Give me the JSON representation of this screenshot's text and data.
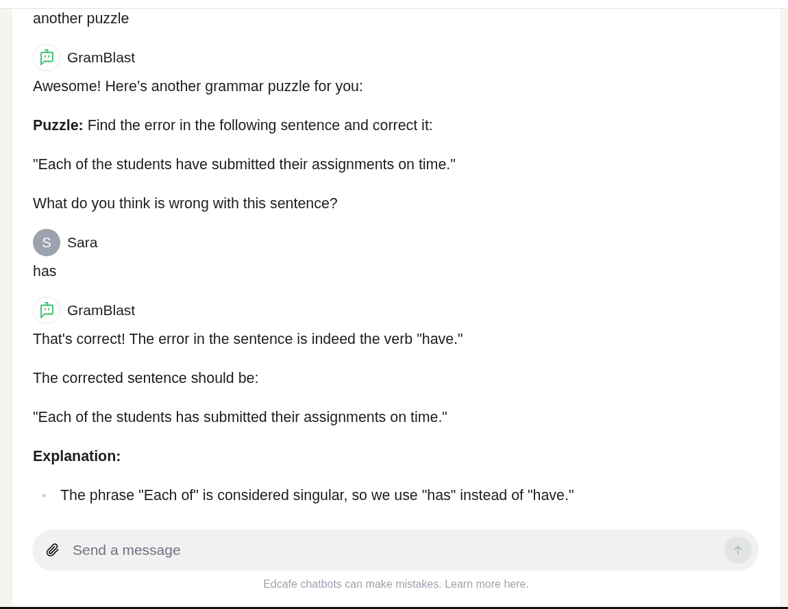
{
  "messages": [
    {
      "blocks": [
        {
          "kind": "paragraph",
          "text": "another puzzle"
        }
      ]
    },
    {
      "sender": {
        "kind": "bot",
        "name": "GramBlast"
      },
      "blocks": [
        {
          "kind": "paragraph",
          "text": "Awesome! Here’s another grammar puzzle for you:"
        },
        {
          "kind": "paragraph",
          "text": "**Puzzle:** Find the error in the following sentence and correct it:"
        },
        {
          "kind": "paragraph",
          "text": "\"Each of the students have submitted their assignments on time.\""
        },
        {
          "kind": "paragraph",
          "text": "What do you think is wrong with this sentence?"
        }
      ]
    },
    {
      "sender": {
        "kind": "user",
        "name": "Sara",
        "initial": "S"
      },
      "blocks": [
        {
          "kind": "paragraph",
          "text": "has"
        }
      ]
    },
    {
      "sender": {
        "kind": "bot",
        "name": "GramBlast"
      },
      "blocks": [
        {
          "kind": "paragraph",
          "text": "That's correct! The error in the sentence is indeed the verb \"have.\""
        },
        {
          "kind": "paragraph",
          "text": "The corrected sentence should be:"
        },
        {
          "kind": "paragraph",
          "text": "\"Each of the students has submitted their assignments on time.\""
        },
        {
          "kind": "heading",
          "text": "Explanation:"
        },
        {
          "kind": "list",
          "items": [
            "The phrase \"Each of\" is considered singular, so we use \"has\" instead of \"have.\""
          ]
        }
      ]
    }
  ],
  "composer": {
    "placeholder": "Send a message",
    "send_button": {
      "disabled": true
    }
  },
  "footer": {
    "text": "Edcafe chatbots can make mistakes. Learn more here."
  }
}
